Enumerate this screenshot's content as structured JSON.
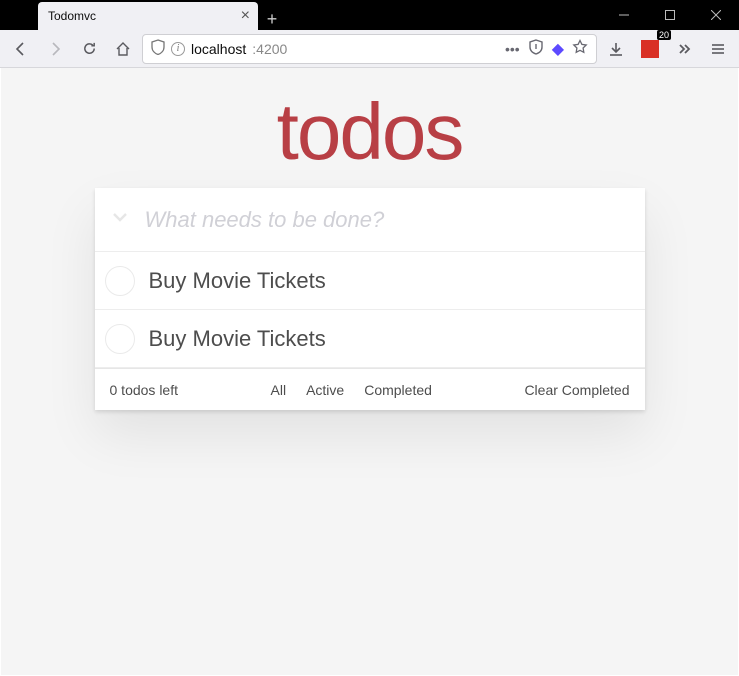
{
  "window": {
    "tab_title": "Todomvc",
    "new_tab_tooltip": "+"
  },
  "address": {
    "host": "localhost",
    "port": ":4200"
  },
  "toolbar_badge": {
    "count": "20"
  },
  "app": {
    "title": "todos",
    "new_todo_placeholder": "What needs to be done?",
    "todos": [
      {
        "label": "Buy Movie Tickets",
        "completed": false
      },
      {
        "label": "Buy Movie Tickets",
        "completed": false
      }
    ],
    "footer": {
      "count_text": "0 todos left",
      "filters": {
        "all": "All",
        "active": "Active",
        "completed": "Completed"
      },
      "clear_label": "Clear Completed"
    }
  }
}
